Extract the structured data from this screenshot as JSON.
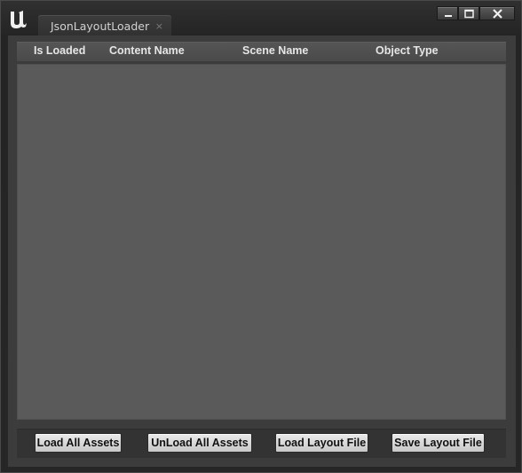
{
  "window": {
    "controls": {
      "minimize": "minimize",
      "maximize": "maximize",
      "close": "close"
    }
  },
  "tab": {
    "title": "JsonLayoutLoader",
    "close_glyph": "×"
  },
  "table": {
    "columns": [
      "Is Loaded",
      "Content Name",
      "Scene Name",
      "Object Type"
    ],
    "rows": []
  },
  "actions": {
    "load_all": "Load All Assets",
    "unload_all": "UnLoad All Assets",
    "load_layout": "Load Layout File",
    "save_layout": "Save Layout File"
  },
  "icons": {
    "app": "unreal-logo-icon",
    "minimize": "minimize-icon",
    "maximize": "maximize-icon",
    "close": "close-icon"
  },
  "colors": {
    "window_bg": "#262626",
    "list_bg": "#5a5a5a",
    "button_bg": "#dcdcdc"
  }
}
